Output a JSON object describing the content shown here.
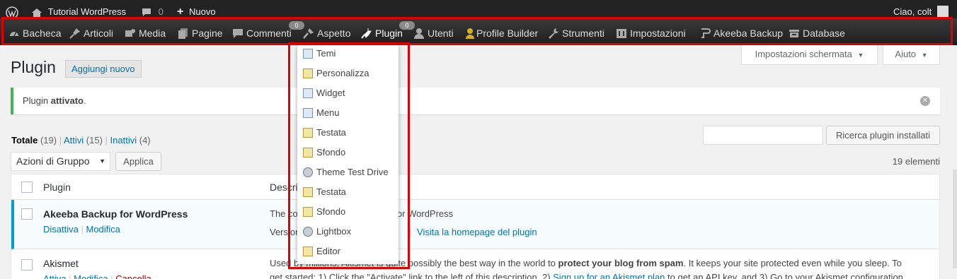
{
  "adminbar": {
    "site_name": "Tutorial WordPress",
    "comments_count": "0",
    "new_label": "Nuovo",
    "greeting": "Ciao, colt"
  },
  "menu": {
    "items": [
      {
        "label": "Bacheca",
        "icon": "dashboard-icon"
      },
      {
        "label": "Articoli",
        "icon": "pin-icon"
      },
      {
        "label": "Media",
        "icon": "media-icon"
      },
      {
        "label": "Pagine",
        "icon": "pages-icon"
      },
      {
        "label": "Commenti",
        "icon": "comments-icon",
        "badge": "0"
      },
      {
        "label": "Aspetto",
        "icon": "appearance-icon"
      },
      {
        "label": "Plugin",
        "icon": "plugins-icon",
        "badge": "0"
      },
      {
        "label": "Utenti",
        "icon": "users-icon"
      },
      {
        "label": "Profile Builder",
        "icon": "profile-builder-icon"
      },
      {
        "label": "Strumenti",
        "icon": "tools-icon"
      },
      {
        "label": "Impostazioni",
        "icon": "settings-icon"
      },
      {
        "label": "Akeeba Backup",
        "icon": "backup-icon"
      },
      {
        "label": "Database",
        "icon": "database-icon"
      }
    ]
  },
  "dropdown": {
    "items": [
      "Temi",
      "Personalizza",
      "Widget",
      "Menu",
      "Testata",
      "Sfondo",
      "Theme Test Drive",
      "Testata",
      "Sfondo",
      "Lightbox",
      "Editor"
    ]
  },
  "screen_meta": {
    "screen_options": "Impostazioni schermata",
    "help": "Aiuto"
  },
  "page": {
    "title": "Plugin",
    "add_new": "Aggiungi nuovo"
  },
  "notice": {
    "prefix": "Plugin ",
    "strong": "attivato",
    "suffix": "."
  },
  "filters": {
    "all_label": "Totale",
    "all_count": "(19)",
    "active_label": "Attivi",
    "active_count": "(15)",
    "inactive_label": "Inattivi",
    "inactive_count": "(4)"
  },
  "search": {
    "button": "Ricerca plugin installati"
  },
  "bulk": {
    "selected": "Azioni di Gruppo",
    "apply": "Applica",
    "items_count": "19 elementi"
  },
  "table": {
    "col_plugin": "Plugin",
    "col_desc": "Descrizione",
    "rows": [
      {
        "name": "Akeeba Backup for WordPress",
        "actions": [
          "Disattiva",
          "Modifica"
        ],
        "desc_line1": "The complete backup solution for WordPress",
        "desc_version": "Version",
        "desc_link": "Visita la homepage del plugin"
      },
      {
        "name": "Akismet",
        "actions": [
          "Attiva",
          "Modifica",
          "Cancella"
        ],
        "desc_line1_a": "Used by millions, Akismet is quite possibly the best way in the world to ",
        "desc_line1_b": "protect your blog from spam",
        "desc_line1_c": ". It keeps your site protected even while you sleep. To",
        "desc_line2_a": "get started: 1) Click the \"Activate\" link to the left of this description, 2) ",
        "desc_line2_link": "Sign up for an Akismet plan",
        "desc_line2_b": " to get an API key, and 3) Go to your Akismet configuration"
      }
    ]
  },
  "colors": {
    "highlight_box": "#e00000",
    "admin_bar": "#222222",
    "link": "#0073aa",
    "notice_success": "#46b450",
    "active_row_border": "#00a0d2"
  }
}
